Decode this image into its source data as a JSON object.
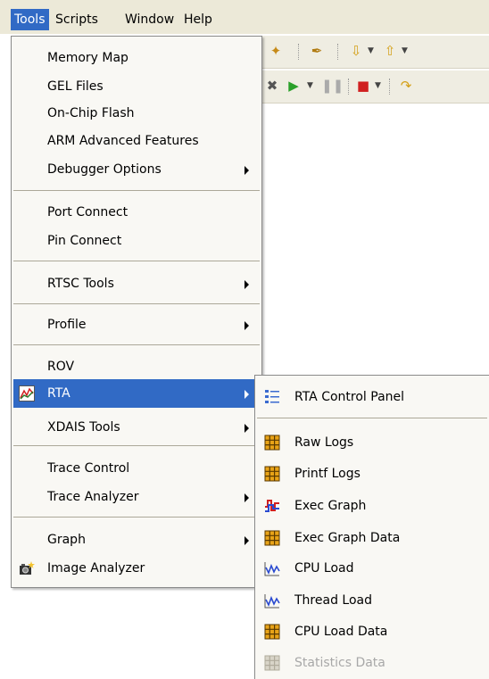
{
  "menubar": {
    "tools": "Tools",
    "scripts": "Scripts",
    "window": "Window",
    "help": "Help"
  },
  "tools_menu": {
    "items": [
      {
        "label": "Memory Map"
      },
      {
        "label": "GEL Files"
      },
      {
        "label": "On-Chip Flash"
      },
      {
        "label": "ARM Advanced Features"
      },
      {
        "label": "Debugger Options",
        "submenu": true
      },
      {
        "label": "Port Connect"
      },
      {
        "label": "Pin Connect"
      },
      {
        "label": "RTSC Tools",
        "submenu": true
      },
      {
        "label": "Profile",
        "submenu": true
      },
      {
        "label": "ROV"
      },
      {
        "label": "RTA",
        "submenu": true,
        "highlighted": true,
        "icon": "rta-chart-icon"
      },
      {
        "label": "XDAIS Tools",
        "submenu": true
      },
      {
        "label": "Trace Control"
      },
      {
        "label": "Trace Analyzer",
        "submenu": true
      },
      {
        "label": "Graph",
        "submenu": true
      },
      {
        "label": "Image Analyzer",
        "icon": "camera-icon"
      }
    ]
  },
  "rta_menu": {
    "items": [
      {
        "label": "RTA Control Panel",
        "icon": "control-panel-icon"
      },
      {
        "label": "Raw Logs",
        "icon": "table-icon"
      },
      {
        "label": "Printf Logs",
        "icon": "table-icon"
      },
      {
        "label": "Exec Graph",
        "icon": "exec-graph-icon"
      },
      {
        "label": "Exec Graph Data",
        "icon": "table-icon"
      },
      {
        "label": "CPU Load",
        "icon": "load-graph-icon"
      },
      {
        "label": "Thread Load",
        "icon": "load-graph-icon"
      },
      {
        "label": "CPU Load Data",
        "icon": "table-icon"
      },
      {
        "label": "Statistics Data",
        "icon": "table-icon",
        "disabled": true
      }
    ]
  },
  "colors": {
    "highlight": "#316ac5",
    "menu_bg": "#f9f8f4",
    "menubar_bg": "#ece9d8",
    "table_icon": "#e8a317"
  }
}
